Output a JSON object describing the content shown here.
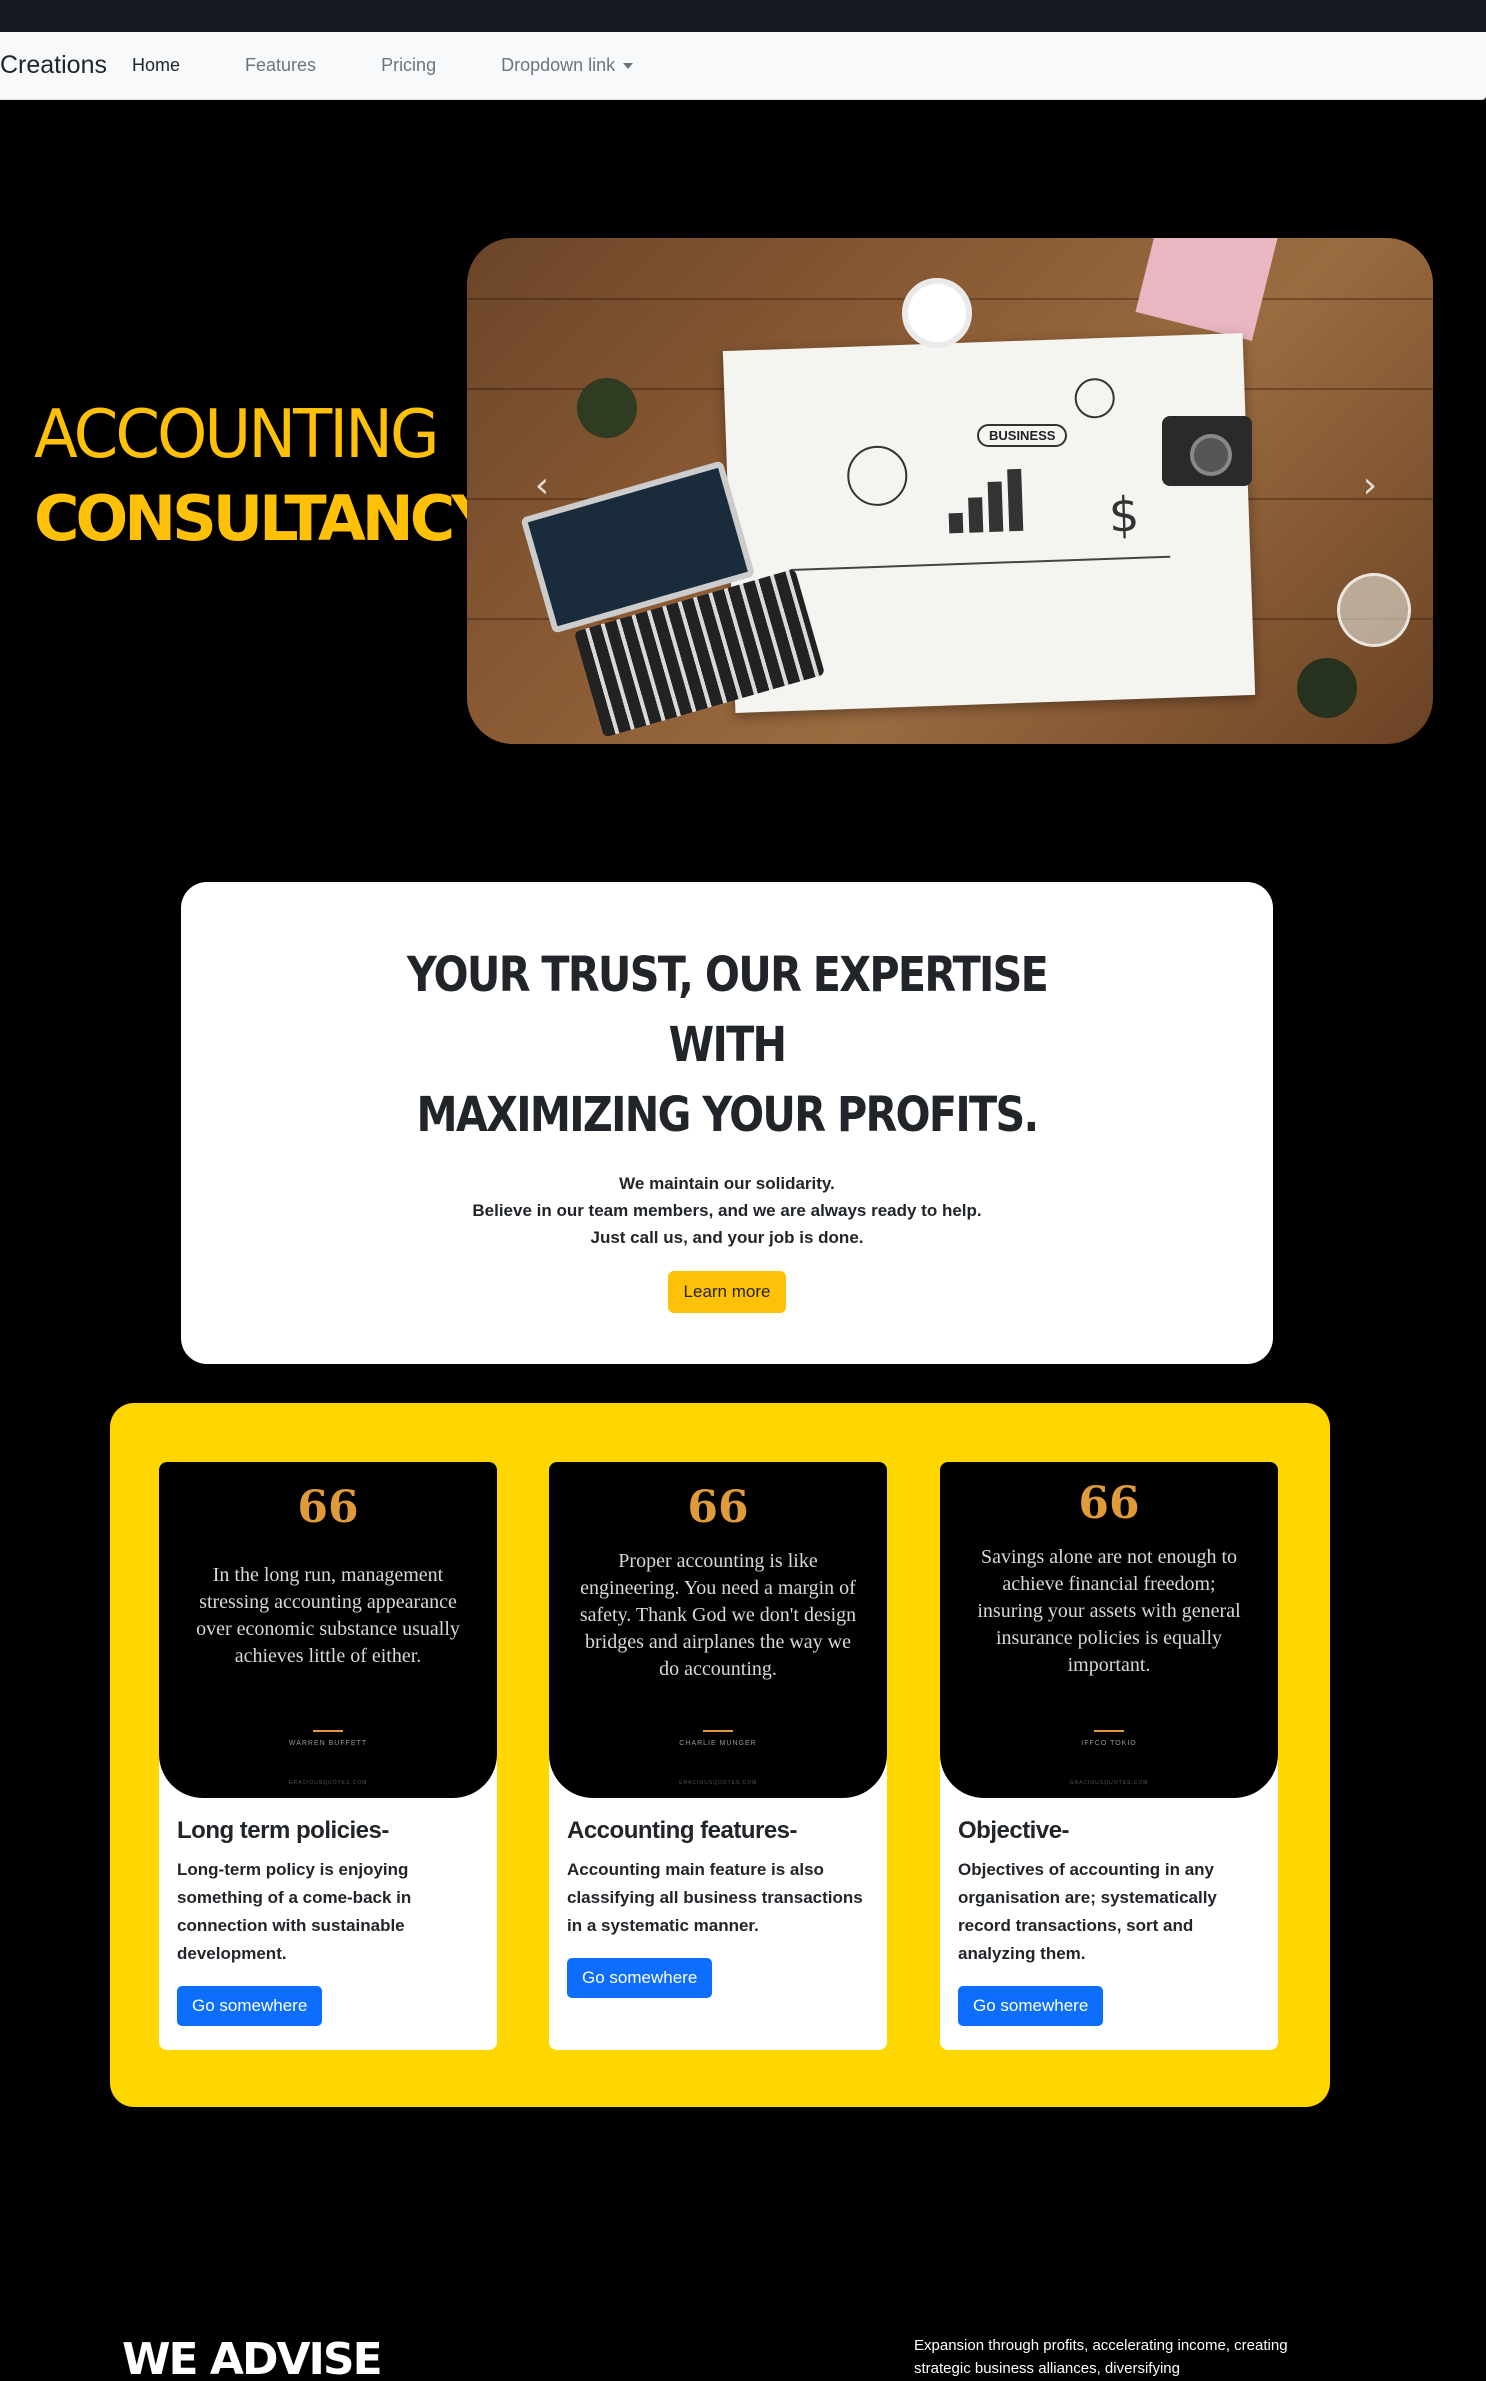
{
  "navbar": {
    "brand": "Creations.",
    "links": [
      {
        "label": "Home",
        "active": true
      },
      {
        "label": "Features"
      },
      {
        "label": "Pricing"
      },
      {
        "label": "Dropdown link"
      }
    ]
  },
  "hero": {
    "title_line1": "ACCOUNTING",
    "title_line2": "CONSULTANCY",
    "carousel": {
      "prev_icon": "chevron-left-icon",
      "next_icon": "chevron-right-icon",
      "paper_label": "BUSINESS"
    }
  },
  "trust": {
    "title_line1": "YOUR TRUST, OUR EXPERTISE",
    "title_line2": "WITH",
    "title_line3": "MAXIMIZING YOUR PROFITS.",
    "text_line1": "We maintain our solidarity.",
    "text_line2": "Believe in our team members, and we are always ready to help.",
    "text_line3": "Just call us, and your job is done.",
    "button": "Learn more"
  },
  "cards": [
    {
      "quote_mark": "66",
      "quote": "In the long run, management stressing accounting appearance over economic substance usually achieves little of either.",
      "author": "WARREN BUFFETT",
      "site": "GRACIOUSQUOTES.COM",
      "title": "Long term policies-",
      "text": "Long-term policy is enjoying something of a come-back in connection with sustainable development.",
      "button": "Go somewhere"
    },
    {
      "quote_mark": "66",
      "quote": "Proper accounting is like engineering. You need a margin of safety. Thank God we don't design bridges and airplanes the way we do accounting.",
      "author": "CHARLIE MUNGER",
      "site": "GRACIOUSQUOTES.COM",
      "title": "Accounting features-",
      "text": "Accounting main feature is also classifying all business transactions in a systematic manner.",
      "button": "Go somewhere"
    },
    {
      "quote_mark": "66",
      "quote": "Savings alone are not enough to achieve financial freedom; insuring your assets with general insurance policies is equally important.",
      "author": "IFFCO TOKIO",
      "site": "GRACIOUSQUOTES.COM",
      "title": "Objective-",
      "text": "Objectives of accounting in any organisation are; systematically record transactions, sort and analyzing them.",
      "button": "Go somewhere"
    }
  ],
  "advise": {
    "title": "WE ADVISE",
    "text": "Expansion through profits, accelerating income, creating strategic business alliances, diversifying"
  },
  "colors": {
    "background": "#000000",
    "accent_yellow": "#ffc107",
    "section_yellow": "#ffd700",
    "primary_blue": "#0d6efd",
    "quote_orange": "#e09a3a"
  }
}
